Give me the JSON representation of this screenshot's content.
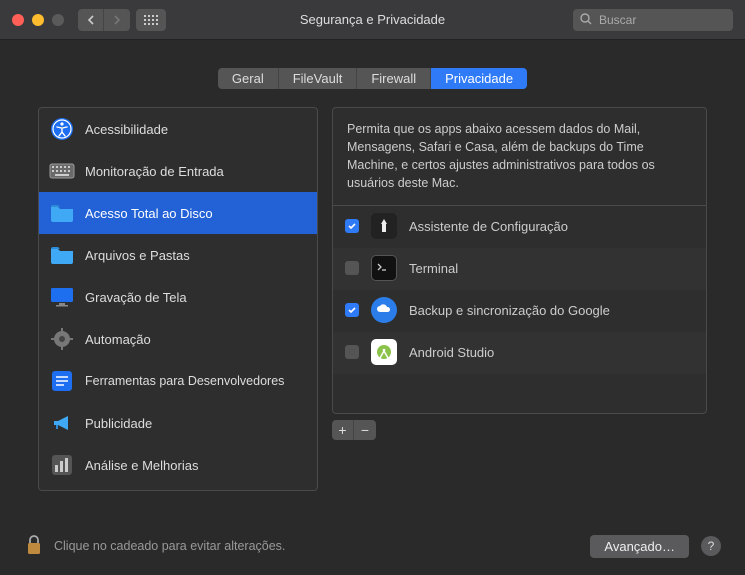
{
  "window": {
    "title": "Segurança e Privacidade"
  },
  "search": {
    "placeholder": "Buscar"
  },
  "tabs": [
    {
      "label": "Geral"
    },
    {
      "label": "FileVault"
    },
    {
      "label": "Firewall"
    },
    {
      "label": "Privacidade"
    }
  ],
  "sidebar": {
    "items": [
      {
        "label": "Acessibilidade"
      },
      {
        "label": "Monitoração de Entrada"
      },
      {
        "label": "Acesso Total ao Disco"
      },
      {
        "label": "Arquivos e Pastas"
      },
      {
        "label": "Gravação de Tela"
      },
      {
        "label": "Automação"
      },
      {
        "label": "Ferramentas para Desenvolvedores"
      },
      {
        "label": "Publicidade"
      },
      {
        "label": "Análise e Melhorias"
      }
    ]
  },
  "info": "Permita que os apps abaixo acessem dados do Mail, Mensagens, Safari e Casa, além de backups do Time Machine, e certos ajustes administrativos para todos os usuários deste Mac.",
  "apps": [
    {
      "label": "Assistente de Configuração",
      "checked": true
    },
    {
      "label": "Terminal",
      "checked": false
    },
    {
      "label": "Backup e sincronização do Google",
      "checked": true
    },
    {
      "label": "Android Studio",
      "checked": false
    }
  ],
  "footer": {
    "lock_text": "Clique no cadeado para evitar alterações.",
    "advanced": "Avançado…"
  }
}
